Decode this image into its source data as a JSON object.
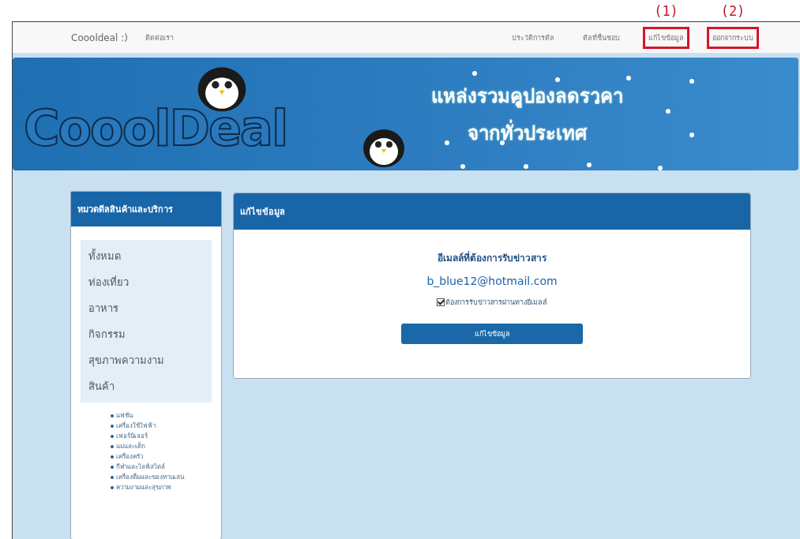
{
  "navbar": {
    "brand": "Coooldeal :)",
    "left_links": [
      "ติดต่อเรา"
    ],
    "right_links": [
      {
        "label": "ประวัติการดีล"
      },
      {
        "label": "ดีลที่ชื่นชอบ"
      },
      {
        "label": "แก้ไขข้อมูล",
        "annotation": "(1)"
      },
      {
        "label": "ออกจากระบบ",
        "annotation": "(2)"
      }
    ]
  },
  "banner": {
    "logo": "CooolDeal",
    "tagline": [
      "แหล่งรวมคูปองลดราคา",
      "จากทั่วประเทศ"
    ]
  },
  "sidebar": {
    "title": "หมวดดีลสินค้าและบริการ",
    "items": [
      {
        "label": "ทั้งหมด"
      },
      {
        "label": "ท่องเที่ยว"
      },
      {
        "label": "อาหาร"
      },
      {
        "label": "กิจกรรม"
      },
      {
        "label": "สุขภาพความงาม"
      },
      {
        "label": "สินค้า",
        "children": [
          {
            "label": "แฟชั่น"
          },
          {
            "label": "เครื่องใช้ไฟฟ้า"
          },
          {
            "label": "เฟอร์นิเจอร์"
          },
          {
            "label": "แม่และเด็ก"
          },
          {
            "label": "เครื่องครัว"
          },
          {
            "label": "กีฬาและไลฟ์สไตล์"
          },
          {
            "label": "เครื่องดื่มและของทานเล่น"
          },
          {
            "label": "ความงามและสุขภาพ"
          }
        ]
      }
    ]
  },
  "panel": {
    "title": "แก้ไขข้อมูล",
    "field_label": "อีเมลล์ที่ต้องการรับข่าวสาร",
    "email": "b_blue12@hotmail.com",
    "subscribe": {
      "label": "ต้องการรับข่าวสารผ่านทางอีเมลล์",
      "checked": true
    },
    "button": "แก้ไขข้อมูล"
  }
}
